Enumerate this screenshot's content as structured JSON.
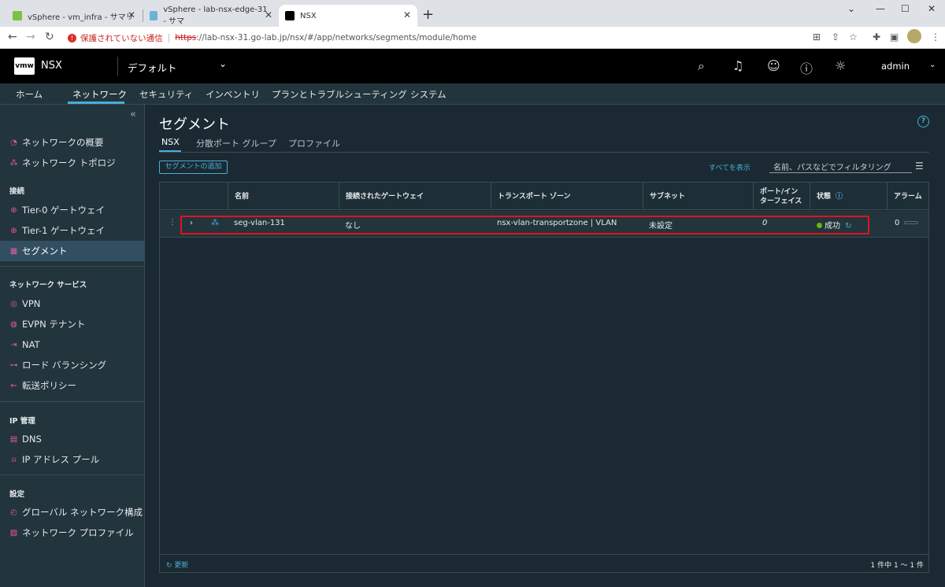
{
  "browser": {
    "tabs": [
      {
        "title": "vSphere - vm_infra - サマリ"
      },
      {
        "title": "vSphere - lab-nsx-edge-31 - サマ"
      },
      {
        "title": "NSX"
      }
    ],
    "insecure_label": "保護されていない通信",
    "url_scheme": "https",
    "url_rest": "://lab-nsx-31.go-lab.jp/nsx/#/app/networks/segments/module/home"
  },
  "header": {
    "logo": "vmw",
    "product": "NSX",
    "tenant": "デフォルト",
    "user": "admin"
  },
  "mainnav": {
    "items": [
      "ホーム",
      "ネットワーク",
      "セキュリティ",
      "インベントリ",
      "プランとトラブルシューティング",
      "システム"
    ]
  },
  "sidebar": {
    "top_items": [
      "ネットワークの概要",
      "ネットワーク トポロジ"
    ],
    "section_connect": "接続",
    "connect_items": [
      "Tier-0 ゲートウェイ",
      "Tier-1 ゲートウェイ",
      "セグメント"
    ],
    "section_services": "ネットワーク サービス",
    "service_items": [
      "VPN",
      "EVPN テナント",
      "NAT",
      "ロード バランシング",
      "転送ポリシー"
    ],
    "section_ip": "IP 管理",
    "ip_items": [
      "DNS",
      "IP アドレス プール"
    ],
    "section_settings": "設定",
    "settings_items": [
      "グローバル ネットワーク構成",
      "ネットワーク プロファイル"
    ]
  },
  "page": {
    "title": "セグメント",
    "subtabs": [
      "NSX",
      "分散ポート グループ",
      "プロファイル"
    ],
    "add_button": "セグメントの追加",
    "show_all": "すべてを表示",
    "filter_placeholder": "名前、パスなどでフィルタリング"
  },
  "grid": {
    "columns": [
      "名前",
      "接続されたゲートウェイ",
      "トランスポート ゾーン",
      "サブネット",
      "ポート/インターフェイス",
      "状態",
      "アラーム"
    ],
    "col_ports_line1": "ポート/イン",
    "col_ports_line2": "ターフェイス",
    "rows": [
      {
        "name": "seg-vlan-131",
        "gateway": "なし",
        "transport_zone": "nsx-vlan-transportzone | VLAN",
        "subnet": "未設定",
        "ports": "0",
        "status": "成功",
        "alarms": "0"
      }
    ],
    "refresh": "更新",
    "page_count": "1 件中 1 ～ 1 件"
  },
  "colors": {
    "accent": "#49afd9",
    "highlight_border": "#e0131f",
    "status_success": "#61b715"
  }
}
